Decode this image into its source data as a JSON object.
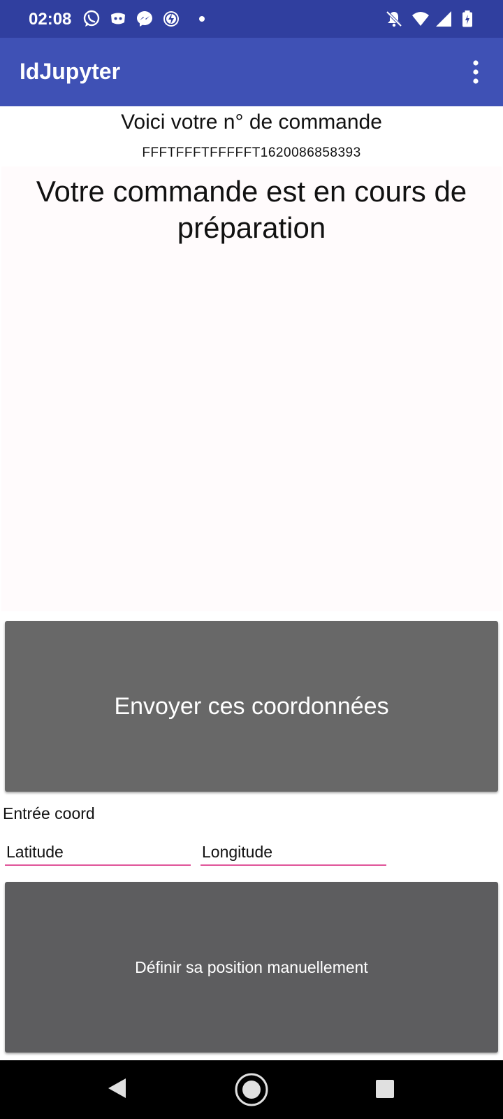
{
  "status_bar": {
    "time": "02:08",
    "left_icons": [
      "whatsapp-icon",
      "discord-icon",
      "messenger-icon",
      "power-save-icon",
      "dot-icon"
    ],
    "right_icons": [
      "notifications-off-icon",
      "wifi-icon",
      "signal-icon",
      "battery-icon"
    ]
  },
  "app_bar": {
    "title": "IdJupyter",
    "menu_icon": "more-vert-icon"
  },
  "order": {
    "label": "Voici votre n° de commande",
    "number": "FFFTFFFTFFFFFT1620086858393"
  },
  "status": {
    "message": "Votre commande est en cours de préparation"
  },
  "send_button": {
    "label": "Envoyer ces coordonnées"
  },
  "coords": {
    "label": "Entrée coord",
    "latitude_placeholder": "Latitude",
    "longitude_placeholder": "Longitude"
  },
  "manual_button": {
    "label": "Définir sa position manuellement"
  },
  "nav": {
    "icons": [
      "back-icon",
      "home-icon",
      "recents-icon"
    ]
  },
  "colors": {
    "status_bar": "#303f9f",
    "app_bar": "#3f51b5",
    "button": "#686868",
    "field_underline": "#e0559a"
  }
}
